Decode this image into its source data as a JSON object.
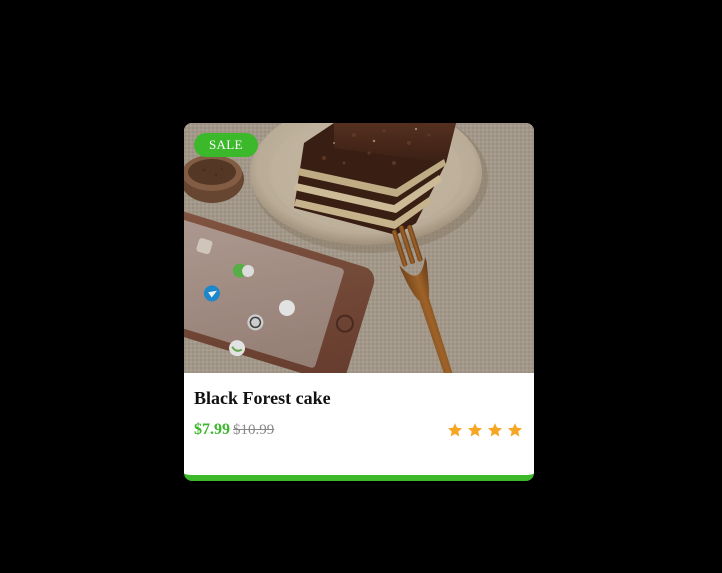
{
  "product": {
    "badge": "SALE",
    "title": "Black Forest cake",
    "price": "$7.99",
    "original_price": "$10.99",
    "rating": 4,
    "star_count": 4
  },
  "colors": {
    "accent": "#3cb82b",
    "star": "#f5a623",
    "background": "#000000",
    "card": "#ffffff"
  },
  "image": {
    "subject": "slice of black forest cake on a plate with a wooden fork, next to a smartphone and a bowl of cocoa on linen"
  }
}
